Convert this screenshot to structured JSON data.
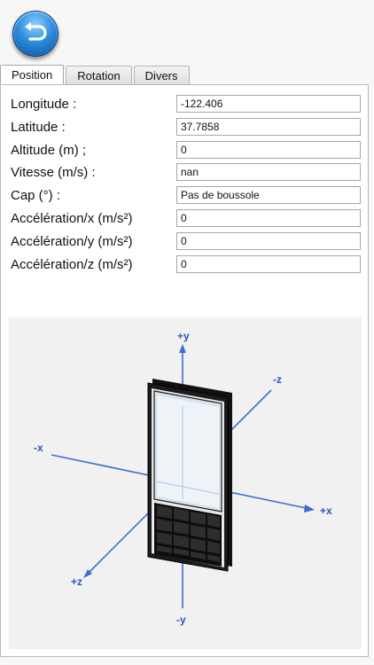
{
  "tabs": [
    {
      "label": "Position",
      "active": true
    },
    {
      "label": "Rotation",
      "active": false
    },
    {
      "label": "Divers",
      "active": false
    }
  ],
  "fields": [
    {
      "label": "Longitude :",
      "value": "-122.406"
    },
    {
      "label": "Latitude :",
      "value": "37.7858"
    },
    {
      "label": "Altitude (m) ;",
      "value": "0"
    },
    {
      "label": "Vitesse (m/s) :",
      "value": "nan"
    },
    {
      "label": "Cap (°) :",
      "value": "Pas de boussole"
    },
    {
      "label": "Accélération/x (m/s²)",
      "value": "0"
    },
    {
      "label": "Accélération/y (m/s²)",
      "value": "0"
    },
    {
      "label": "Accélération/z (m/s²)",
      "value": "0"
    }
  ],
  "axes": {
    "plus_y": "+y",
    "minus_y": "-y",
    "plus_x": "+x",
    "minus_x": "-x",
    "plus_z": "+z",
    "minus_z": "-z"
  },
  "colors": {
    "axis": "#3a6fd0",
    "axis_label": "#2a58b8",
    "back_button": "#2d8fe0"
  },
  "icons": {
    "back": "back-arrow-icon"
  }
}
